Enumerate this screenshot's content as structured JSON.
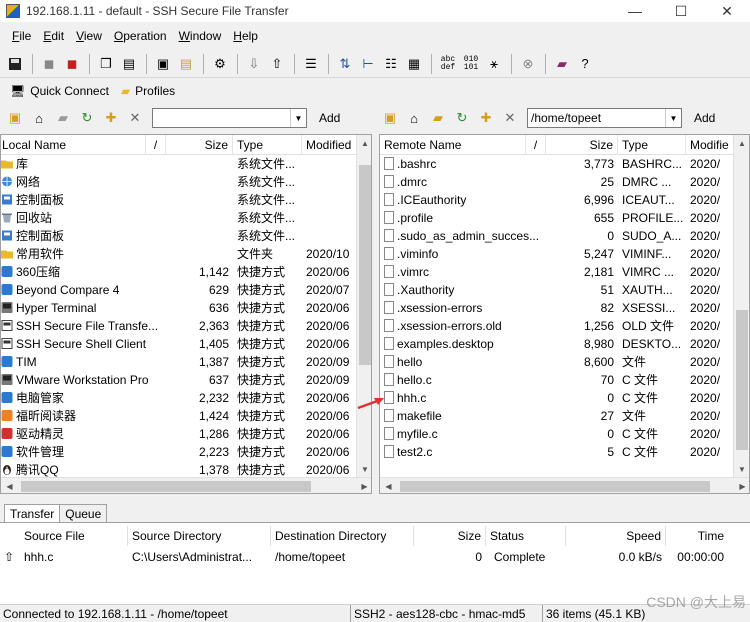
{
  "window": {
    "title": "192.168.1.11 - default - SSH Secure File Transfer",
    "controls": [
      "—",
      "☐",
      "✕"
    ]
  },
  "menu": [
    {
      "key": "F",
      "rest": "ile"
    },
    {
      "key": "E",
      "rest": "dit"
    },
    {
      "key": "V",
      "rest": "iew"
    },
    {
      "key": "O",
      "rest": "peration"
    },
    {
      "key": "W",
      "rest": "indow"
    },
    {
      "key": "H",
      "rest": "elp"
    }
  ],
  "toolbar": {
    "btn_abc_def": "abc def",
    "btn_010_101": "010 101",
    "btn_help": "?"
  },
  "quick": {
    "connect_label": "Quick Connect",
    "profiles_label": "Profiles"
  },
  "local": {
    "path": "",
    "add_label": "Add",
    "columns": [
      "Local Name",
      "/",
      "Size",
      "Type",
      "Modified"
    ],
    "rows": [
      {
        "name": "库",
        "size": "",
        "type": "系统文件...",
        "modified": ""
      },
      {
        "name": "网络",
        "size": "",
        "type": "系统文件...",
        "modified": ""
      },
      {
        "name": "控制面板",
        "size": "",
        "type": "系统文件...",
        "modified": ""
      },
      {
        "name": "回收站",
        "size": "",
        "type": "系统文件...",
        "modified": ""
      },
      {
        "name": "控制面板",
        "size": "",
        "type": "系统文件...",
        "modified": ""
      },
      {
        "name": "常用软件",
        "size": "",
        "type": "文件夹",
        "modified": "2020/10"
      },
      {
        "name": "360压缩",
        "size": "1,142",
        "type": "快捷方式",
        "modified": "2020/06"
      },
      {
        "name": "Beyond Compare 4",
        "size": "629",
        "type": "快捷方式",
        "modified": "2020/07"
      },
      {
        "name": "Hyper Terminal",
        "size": "636",
        "type": "快捷方式",
        "modified": "2020/06"
      },
      {
        "name": "SSH Secure File Transfe...",
        "size": "2,363",
        "type": "快捷方式",
        "modified": "2020/06"
      },
      {
        "name": "SSH Secure Shell Client",
        "size": "1,405",
        "type": "快捷方式",
        "modified": "2020/06"
      },
      {
        "name": "TIM",
        "size": "1,387",
        "type": "快捷方式",
        "modified": "2020/09"
      },
      {
        "name": "VMware Workstation Pro",
        "size": "637",
        "type": "快捷方式",
        "modified": "2020/09"
      },
      {
        "name": "电脑管家",
        "size": "2,232",
        "type": "快捷方式",
        "modified": "2020/06"
      },
      {
        "name": "福昕阅读器",
        "size": "1,424",
        "type": "快捷方式",
        "modified": "2020/06"
      },
      {
        "name": "驱动精灵",
        "size": "1,286",
        "type": "快捷方式",
        "modified": "2020/06"
      },
      {
        "name": "软件管理",
        "size": "2,223",
        "type": "快捷方式",
        "modified": "2020/06"
      },
      {
        "name": "腾讯QQ",
        "size": "1,378",
        "type": "快捷方式",
        "modified": "2020/06"
      }
    ]
  },
  "remote": {
    "path": "/home/topeet",
    "add_label": "Add",
    "columns": [
      "Remote Name",
      "/",
      "Size",
      "Type",
      "Modifie"
    ],
    "rows": [
      {
        "name": ".bashrc",
        "size": "3,773",
        "type": "BASHRC...",
        "modified": "2020/"
      },
      {
        "name": ".dmrc",
        "size": "25",
        "type": "DMRC ...",
        "modified": "2020/"
      },
      {
        "name": ".ICEauthority",
        "size": "6,996",
        "type": "ICEAUT...",
        "modified": "2020/"
      },
      {
        "name": ".profile",
        "size": "655",
        "type": "PROFILE...",
        "modified": "2020/"
      },
      {
        "name": ".sudo_as_admin_succes...",
        "size": "0",
        "type": "SUDO_A...",
        "modified": "2020/"
      },
      {
        "name": ".viminfo",
        "size": "5,247",
        "type": "VIMINF...",
        "modified": "2020/"
      },
      {
        "name": ".vimrc",
        "size": "2,181",
        "type": "VIMRC ...",
        "modified": "2020/"
      },
      {
        "name": ".Xauthority",
        "size": "51",
        "type": "XAUTH...",
        "modified": "2020/"
      },
      {
        "name": ".xsession-errors",
        "size": "82",
        "type": "XSESSI...",
        "modified": "2020/"
      },
      {
        "name": ".xsession-errors.old",
        "size": "1,256",
        "type": "OLD 文件",
        "modified": "2020/"
      },
      {
        "name": "examples.desktop",
        "size": "8,980",
        "type": "DESKTO...",
        "modified": "2020/"
      },
      {
        "name": "hello",
        "size": "8,600",
        "type": "文件",
        "modified": "2020/"
      },
      {
        "name": "hello.c",
        "size": "70",
        "type": "C 文件",
        "modified": "2020/"
      },
      {
        "name": "hhh.c",
        "size": "0",
        "type": "C 文件",
        "modified": "2020/"
      },
      {
        "name": "makefile",
        "size": "27",
        "type": "文件",
        "modified": "2020/"
      },
      {
        "name": "myfile.c",
        "size": "0",
        "type": "C 文件",
        "modified": "2020/"
      },
      {
        "name": "test2.c",
        "size": "5",
        "type": "C 文件",
        "modified": "2020/"
      }
    ]
  },
  "transfer": {
    "tabs": [
      "Transfer",
      "Queue"
    ],
    "columns": [
      "Source File",
      "Source Directory",
      "Destination Directory",
      "Size",
      "Status",
      "Speed",
      "Time"
    ],
    "rows": [
      {
        "icon": "⇧",
        "file": "hhh.c",
        "src": "C:\\Users\\Administrat...",
        "dst": "/home/topeet",
        "size": "0",
        "status": "Complete",
        "speed": "0.0 kB/s",
        "time": "00:00:00"
      }
    ]
  },
  "status": {
    "connection": "Connected to 192.168.1.11 - /home/topeet",
    "cipher": "SSH2 - aes128-cbc - hmac-md5",
    "items": "36 items (45.1 KB)"
  },
  "watermark": "CSDN @大上易",
  "colors": {
    "annotation_arrow": "#e03030",
    "folder": "#e8b830",
    "selection": "#c8c8c8"
  },
  "local_icons": [
    "folder",
    "network",
    "control",
    "recycle",
    "control",
    "folder",
    "app-blue",
    "app-blue",
    "app-gray",
    "doc",
    "doc",
    "app-blue",
    "app-gray",
    "app-blue",
    "app-orange",
    "app-red",
    "app-blue",
    "app-penguin"
  ]
}
